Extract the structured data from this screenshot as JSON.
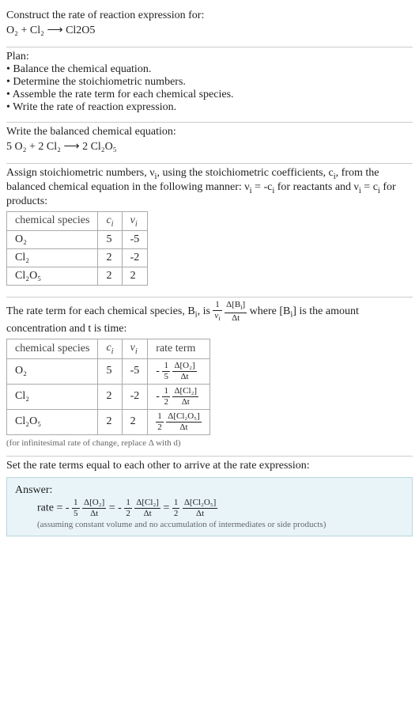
{
  "header": {
    "prompt": "Construct the rate of reaction expression for:",
    "unbalanced": "O₂ + Cl₂ ⟶ Cl2O5"
  },
  "plan": {
    "title": "Plan:",
    "items": [
      "Balance the chemical equation.",
      "Determine the stoichiometric numbers.",
      "Assemble the rate term for each chemical species.",
      "Write the rate of reaction expression."
    ]
  },
  "balance": {
    "title": "Write the balanced chemical equation:",
    "equation": "5 O₂ + 2 Cl₂ ⟶ 2 Cl₂O₅"
  },
  "stoich": {
    "intro_a": "Assign stoichiometric numbers, ν",
    "intro_b": ", using the stoichiometric coefficients, c",
    "intro_c": ", from the balanced chemical equation in the following manner: ν",
    "intro_d": " = -c",
    "intro_e": " for reactants and ν",
    "intro_f": " = c",
    "intro_g": " for products:",
    "headers": {
      "species": "chemical species",
      "c": "cᵢ",
      "nu": "νᵢ"
    },
    "rows": [
      {
        "species": "O₂",
        "c": "5",
        "nu": "-5"
      },
      {
        "species": "Cl₂",
        "c": "2",
        "nu": "-2"
      },
      {
        "species": "Cl₂O₅",
        "c": "2",
        "nu": "2"
      }
    ]
  },
  "rateterm": {
    "intro_a": "The rate term for each chemical species, B",
    "intro_b": ", is ",
    "intro_c": " where [B",
    "intro_d": "] is the amount concentration and t is time:",
    "frac1_num": "1",
    "frac1_den": "νᵢ",
    "frac2_num": "Δ[Bᵢ]",
    "frac2_den": "Δt",
    "headers": {
      "species": "chemical species",
      "c": "cᵢ",
      "nu": "νᵢ",
      "rt": "rate term"
    },
    "rows": [
      {
        "species": "O₂",
        "c": "5",
        "nu": "-5",
        "sign": "-",
        "coef_num": "1",
        "coef_den": "5",
        "conc_num": "Δ[O₂]",
        "conc_den": "Δt"
      },
      {
        "species": "Cl₂",
        "c": "2",
        "nu": "-2",
        "sign": "-",
        "coef_num": "1",
        "coef_den": "2",
        "conc_num": "Δ[Cl₂]",
        "conc_den": "Δt"
      },
      {
        "species": "Cl₂O₅",
        "c": "2",
        "nu": "2",
        "sign": "",
        "coef_num": "1",
        "coef_den": "2",
        "conc_num": "Δ[Cl₂O₅]",
        "conc_den": "Δt"
      }
    ],
    "note": "(for infinitesimal rate of change, replace Δ with d)"
  },
  "final": {
    "title": "Set the rate terms equal to each other to arrive at the rate expression:",
    "answer_label": "Answer:",
    "rate_label": "rate = ",
    "eq": " = ",
    "neg": "-",
    "terms": [
      {
        "sign": "-",
        "coef_num": "1",
        "coef_den": "5",
        "conc_num": "Δ[O₂]",
        "conc_den": "Δt"
      },
      {
        "sign": "-",
        "coef_num": "1",
        "coef_den": "2",
        "conc_num": "Δ[Cl₂]",
        "conc_den": "Δt"
      },
      {
        "sign": "",
        "coef_num": "1",
        "coef_den": "2",
        "conc_num": "Δ[Cl₂O₅]",
        "conc_den": "Δt"
      }
    ],
    "assumption": "(assuming constant volume and no accumulation of intermediates or side products)"
  },
  "chart_data": {
    "type": "table",
    "tables": [
      {
        "title": "Stoichiometric numbers",
        "columns": [
          "chemical species",
          "c_i",
          "nu_i"
        ],
        "rows": [
          [
            "O2",
            5,
            -5
          ],
          [
            "Cl2",
            2,
            -2
          ],
          [
            "Cl2O5",
            2,
            2
          ]
        ]
      },
      {
        "title": "Rate terms",
        "columns": [
          "chemical species",
          "c_i",
          "nu_i",
          "rate term"
        ],
        "rows": [
          [
            "O2",
            5,
            -5,
            "-(1/5) Δ[O2]/Δt"
          ],
          [
            "Cl2",
            2,
            -2,
            "-(1/2) Δ[Cl2]/Δt"
          ],
          [
            "Cl2O5",
            2,
            2,
            "(1/2) Δ[Cl2O5]/Δt"
          ]
        ]
      }
    ]
  }
}
